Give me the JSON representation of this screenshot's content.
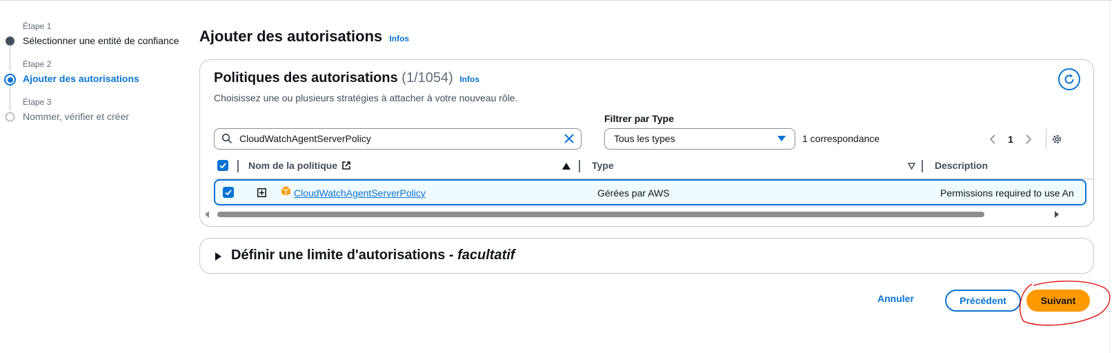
{
  "stepper": {
    "steps": [
      {
        "caption": "Étape 1",
        "title": "Sélectionner une entité de confiance",
        "state": "completed"
      },
      {
        "caption": "Étape 2",
        "title": "Ajouter des autorisations",
        "state": "current"
      },
      {
        "caption": "Étape 3",
        "title": "Nommer, vérifier et créer",
        "state": "upcoming"
      }
    ]
  },
  "header": {
    "title": "Ajouter des autorisations",
    "info": "Infos"
  },
  "permissions": {
    "title": "Politiques des autorisations",
    "count": "(1/1054)",
    "info": "Infos",
    "description": "Choisissez une ou plusieurs stratégies à attacher à votre nouveau rôle.",
    "search_value": "CloudWatchAgentServerPolicy",
    "filter_label": "Filtrer par Type",
    "filter_value": "Tous les types",
    "matches": "1 correspondance",
    "page": "1",
    "columns": {
      "name": "Nom de la politique",
      "type": "Type",
      "description": "Description"
    },
    "rows": [
      {
        "name": "CloudWatchAgentServerPolicy",
        "type": "Gérées par AWS",
        "description": "Permissions required to use An",
        "selected": true
      }
    ]
  },
  "boundary": {
    "title": "Définir une limite d'autorisations - ",
    "optional": "facultatif"
  },
  "actions": {
    "cancel": "Annuler",
    "previous": "Précédent",
    "next": "Suivant"
  },
  "colors": {
    "accent": "#0972d3",
    "primary_button": "#ff9900",
    "annotation": "#e00000"
  }
}
